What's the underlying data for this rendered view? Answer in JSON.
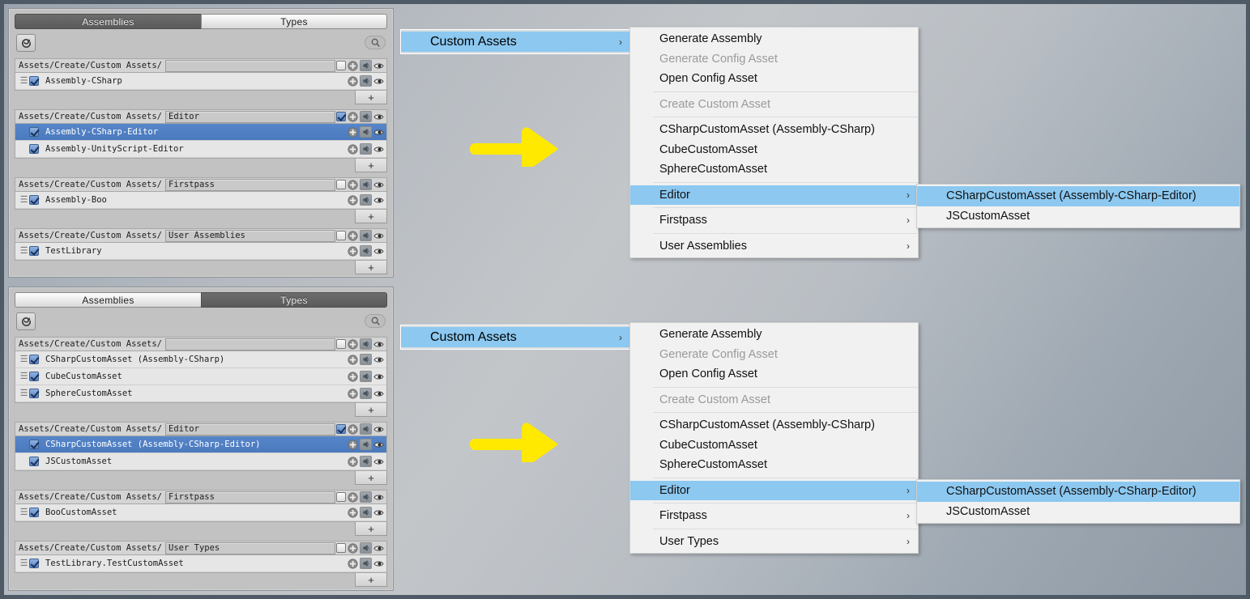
{
  "window": {
    "background_top": "#9aa3ad",
    "background_mid": "#c3c6c9",
    "frame_color": "#4e5a66"
  },
  "icons": {
    "refresh": "refresh-icon",
    "search": "search-icon",
    "add": "add-circle-icon",
    "script": "script-icon",
    "visibility": "eye-icon",
    "drag": "drag-handle-icon",
    "plus": "plus-icon",
    "chevron": "chevron-right-icon"
  },
  "colors": {
    "selection_blue": "#4b79bd",
    "menu_highlight": "#8cc8f0",
    "arrow_yellow": "#ffe900"
  },
  "panels": [
    {
      "id": "assemblies-panel",
      "tabs": [
        {
          "label": "Assemblies",
          "active": true
        },
        {
          "label": "Types",
          "active": false
        }
      ],
      "path_prefix": "Assets/Create/Custom Assets/",
      "add_label": "+",
      "groups": [
        {
          "path_value": "",
          "path_checked": false,
          "rows": [
            {
              "label": "Assembly-CSharp",
              "checked": true,
              "drag": true,
              "selected": false
            }
          ]
        },
        {
          "path_value": "Editor",
          "path_checked": true,
          "rows": [
            {
              "label": "Assembly-CSharp-Editor",
              "checked": true,
              "drag": false,
              "selected": true
            },
            {
              "label": "Assembly-UnityScript-Editor",
              "checked": true,
              "drag": false,
              "selected": false
            }
          ]
        },
        {
          "path_value": "Firstpass",
          "path_checked": false,
          "rows": [
            {
              "label": "Assembly-Boo",
              "checked": true,
              "drag": true,
              "selected": false
            }
          ]
        },
        {
          "path_value": "User Assemblies",
          "path_checked": false,
          "rows": [
            {
              "label": "TestLibrary",
              "checked": true,
              "drag": true,
              "selected": false
            }
          ]
        }
      ]
    },
    {
      "id": "types-panel",
      "tabs": [
        {
          "label": "Assemblies",
          "active": false
        },
        {
          "label": "Types",
          "active": true
        }
      ],
      "path_prefix": "Assets/Create/Custom Assets/",
      "add_label": "+",
      "groups": [
        {
          "path_value": "",
          "path_checked": false,
          "rows": [
            {
              "label": "CSharpCustomAsset (Assembly-CSharp)",
              "checked": true,
              "drag": true,
              "selected": false
            },
            {
              "label": "CubeCustomAsset",
              "checked": true,
              "drag": true,
              "selected": false
            },
            {
              "label": "SphereCustomAsset",
              "checked": true,
              "drag": true,
              "selected": false
            }
          ]
        },
        {
          "path_value": "Editor",
          "path_checked": true,
          "rows": [
            {
              "label": "CSharpCustomAsset (Assembly-CSharp-Editor)",
              "checked": true,
              "drag": false,
              "selected": true
            },
            {
              "label": "JSCustomAsset",
              "checked": true,
              "drag": false,
              "selected": false
            }
          ]
        },
        {
          "path_value": "Firstpass",
          "path_checked": false,
          "rows": [
            {
              "label": "BooCustomAsset",
              "checked": true,
              "drag": true,
              "selected": false
            }
          ]
        },
        {
          "path_value": "User Types",
          "path_checked": false,
          "rows": [
            {
              "label": "TestLibrary.TestCustomAsset",
              "checked": true,
              "drag": true,
              "selected": false
            }
          ]
        }
      ]
    }
  ],
  "menus": [
    {
      "id": "menu-top",
      "parent_item": {
        "label": "Custom Assets",
        "highlighted": true,
        "submenu": true
      },
      "items": [
        {
          "label": "Generate Assembly",
          "disabled": false,
          "submenu": false,
          "highlighted": false
        },
        {
          "label": "Generate Config Asset",
          "disabled": true,
          "submenu": false,
          "highlighted": false
        },
        {
          "label": "Open Config Asset",
          "disabled": false,
          "submenu": false,
          "highlighted": false
        },
        {
          "separator": true
        },
        {
          "label": "Create Custom Asset",
          "disabled": true,
          "submenu": false,
          "highlighted": false
        },
        {
          "separator": true
        },
        {
          "label": "CSharpCustomAsset (Assembly-CSharp)",
          "disabled": false,
          "submenu": false,
          "highlighted": false
        },
        {
          "label": "CubeCustomAsset",
          "disabled": false,
          "submenu": false,
          "highlighted": false
        },
        {
          "label": "SphereCustomAsset",
          "disabled": false,
          "submenu": false,
          "highlighted": false
        },
        {
          "separator": true
        },
        {
          "label": "Editor",
          "disabled": false,
          "submenu": true,
          "highlighted": true
        },
        {
          "separator": true
        },
        {
          "label": "Firstpass",
          "disabled": false,
          "submenu": true,
          "highlighted": false
        },
        {
          "separator": true
        },
        {
          "label": "User Assemblies",
          "disabled": false,
          "submenu": true,
          "highlighted": false
        }
      ],
      "submenu": {
        "items": [
          {
            "label": "CSharpCustomAsset (Assembly-CSharp-Editor)",
            "highlighted": true
          },
          {
            "label": "JSCustomAsset",
            "highlighted": false
          }
        ]
      }
    },
    {
      "id": "menu-bottom",
      "parent_item": {
        "label": "Custom Assets",
        "highlighted": true,
        "submenu": true
      },
      "items": [
        {
          "label": "Generate Assembly",
          "disabled": false,
          "submenu": false,
          "highlighted": false
        },
        {
          "label": "Generate Config Asset",
          "disabled": true,
          "submenu": false,
          "highlighted": false
        },
        {
          "label": "Open Config Asset",
          "disabled": false,
          "submenu": false,
          "highlighted": false
        },
        {
          "separator": true
        },
        {
          "label": "Create Custom Asset",
          "disabled": true,
          "submenu": false,
          "highlighted": false
        },
        {
          "separator": true
        },
        {
          "label": "CSharpCustomAsset (Assembly-CSharp)",
          "disabled": false,
          "submenu": false,
          "highlighted": false
        },
        {
          "label": "CubeCustomAsset",
          "disabled": false,
          "submenu": false,
          "highlighted": false
        },
        {
          "label": "SphereCustomAsset",
          "disabled": false,
          "submenu": false,
          "highlighted": false
        },
        {
          "separator": true
        },
        {
          "label": "Editor",
          "disabled": false,
          "submenu": true,
          "highlighted": true
        },
        {
          "separator": true
        },
        {
          "label": "Firstpass",
          "disabled": false,
          "submenu": true,
          "highlighted": false
        },
        {
          "separator": true
        },
        {
          "label": "User Types",
          "disabled": false,
          "submenu": true,
          "highlighted": false
        }
      ],
      "submenu": {
        "items": [
          {
            "label": "CSharpCustomAsset (Assembly-CSharp-Editor)",
            "highlighted": true
          },
          {
            "label": "JSCustomAsset",
            "highlighted": false
          }
        ]
      }
    }
  ],
  "annotations": [
    {
      "name": "arrow-top",
      "color": "#ffe900"
    },
    {
      "name": "arrow-bottom",
      "color": "#ffe900"
    }
  ]
}
